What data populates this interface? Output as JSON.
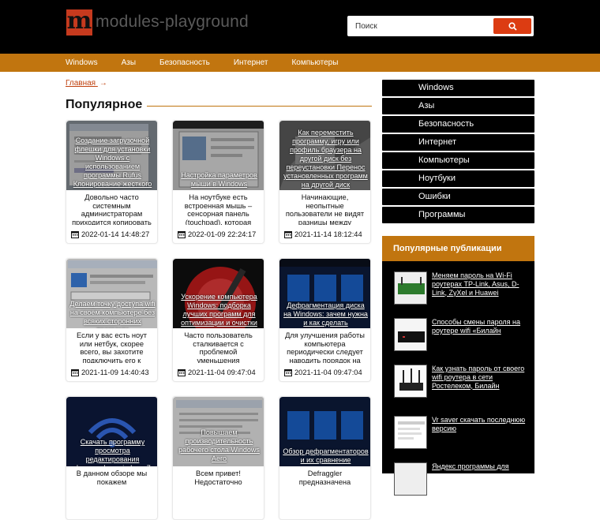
{
  "header": {
    "logo_letter": "m",
    "logo_text": "modules-playground",
    "search_placeholder": "Поиск"
  },
  "nav": [
    "Windows",
    "Азы",
    "Безопасность",
    "Интернет",
    "Компьютеры"
  ],
  "breadcrumb": {
    "home": "Главная",
    "arrow": "→"
  },
  "section_title": "Популярное",
  "cards": [
    {
      "title": "Создание загрузочной флешки для установки Windows с использованием программы Rufus Клонирование жесткого диска",
      "excerpt": "Довольно часто системным администраторам приходится копировать различные данные",
      "date": "2022-01-14 14:48:27"
    },
    {
      "title": "Настройка параметров мыши в Windows",
      "excerpt": "На ноутбуке есть встроенная мышь – сенсорная панель (touchpad), которая обычно",
      "date": "2022-01-09 22:24:17"
    },
    {
      "title": "Как переместить программу, игру или профиль браузера на другой диск без переустановки Перенос установленных программ на другой диск",
      "excerpt": "Начинающие, неопытные пользователи не видят разницы между логическими дисками",
      "date": "2021-11-14 18:12:44"
    },
    {
      "title": "Делаем точку доступа wifi на своём компьютере без всяких сторонних программ",
      "excerpt": "Если у вас есть ноут или нетбук, скорее всего, вы захотите подключить его к домашней сети без",
      "date": "2021-11-09 14:40:43"
    },
    {
      "title": "Ускорение компьютера Windows: подборка лучших программ для оптимизации и очистки",
      "excerpt": "Часто пользователь сталкивается с проблемой уменьшения быстродействия ПК",
      "date": "2021-11-04 09:47:04"
    },
    {
      "title": "Дефрагментация диска на Windows: зачем нужна и как сделать",
      "excerpt": "Для улучшения работы компьютера периодически следует наводить порядок на жёстких дисках. Утилиты",
      "date": "2021-11-04 09:47:04"
    },
    {
      "title": "Скачать программу просмотра редактирования фотографии windows 7",
      "excerpt": "В данном обзоре мы покажем",
      "date": ""
    },
    {
      "title": "Повышаем производительность рабочего стола Windows Aero",
      "excerpt": "Всем привет! Недостаточно",
      "date": ""
    },
    {
      "title": "Обзор дефрагментаторов и их сравнение",
      "excerpt": "Defraggler предназначена",
      "date": ""
    }
  ],
  "sidebar_menu": [
    "Windows",
    "Азы",
    "Безопасность",
    "Интернет",
    "Компьютеры",
    "Ноутбуки",
    "Ошибки",
    "Программы"
  ],
  "popular": {
    "title": "Популярные публикации",
    "items": [
      "Меняем пароль на Wi-Fi роутерах TP-Link, Asus, D-Link, ZyXel и Huawei",
      "Способы смены пароля на роутере wifi «Билайн",
      "Как узнать пароль от своего wifi роутера в сети Ростелеком, Билайн",
      "Vr saver скачать последнюю версию",
      "Яндекс программы для"
    ]
  },
  "colors": {
    "accent": "#c1750f",
    "search_button": "#dc3c12",
    "logo_mark": "#c63a1e"
  }
}
